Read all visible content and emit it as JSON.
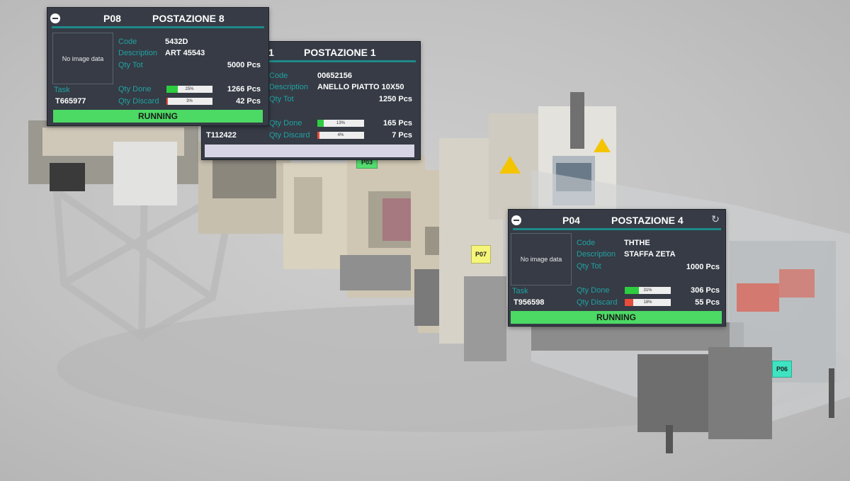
{
  "colors": {
    "panel_bg": "#363b45",
    "accent": "#1d8a8a",
    "label": "#1fa3a3",
    "running": "#4cd964",
    "idle": "#d8d6e6",
    "done_fill": "#2ecc40",
    "discard_fill": "#e74c3c"
  },
  "markers": [
    {
      "label": "P03",
      "color": "#55e070"
    },
    {
      "label": "P07",
      "color": "#f5f57a"
    },
    {
      "label": "P06",
      "color": "#3fe3c2"
    }
  ],
  "stations": {
    "p08": {
      "code": "P08",
      "name": "POSTAZIONE 8",
      "image_placeholder": "No image data",
      "labels": {
        "code": "Code",
        "description": "Description",
        "qty_tot": "Qty Tot",
        "task": "Task",
        "qty_done": "Qty Done",
        "qty_discard": "Qty Discard"
      },
      "item_code": "5432D",
      "description": "ART 45543",
      "qty_tot": "5000",
      "task": "T665977",
      "qty_done": "1266",
      "qty_discard": "42",
      "unit": "Pcs",
      "done_pct": 25,
      "done_pct_label": "25%",
      "discard_pct": 3,
      "discard_pct_label": "3%",
      "status": "RUNNING"
    },
    "p01": {
      "code": "1",
      "name": "POSTAZIONE 1",
      "labels": {
        "code": "Code",
        "description": "Description",
        "qty_tot": "Qty Tot",
        "qty_done": "Qty Done",
        "qty_discard": "Qty Discard"
      },
      "item_code": "00652156",
      "description": "ANELLO PIATTO 10X50",
      "qty_tot": "1250",
      "task": "T112422",
      "qty_done": "165",
      "qty_discard": "7",
      "unit": "Pcs",
      "done_pct": 13,
      "done_pct_label": "13%",
      "discard_pct": 4,
      "discard_pct_label": "4%",
      "status": ""
    },
    "p04": {
      "code": "P04",
      "name": "POSTAZIONE 4",
      "image_placeholder": "No image data",
      "labels": {
        "code": "Code",
        "description": "Description",
        "qty_tot": "Qty Tot",
        "task": "Task",
        "qty_done": "Qty Done",
        "qty_discard": "Qty Discard"
      },
      "item_code": "THTHE",
      "description": "STAFFA ZETA",
      "qty_tot": "1000",
      "task": "T956598",
      "qty_done": "306",
      "qty_discard": "55",
      "unit": "Pcs",
      "done_pct": 31,
      "done_pct_label": "31%",
      "discard_pct": 18,
      "discard_pct_label": "18%",
      "status": "RUNNING"
    }
  }
}
